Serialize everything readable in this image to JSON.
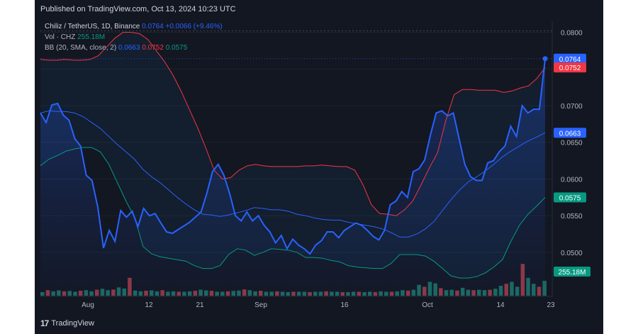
{
  "header": {
    "published": "Published on TradingView.com, Oct 13, 2024 10:23 UTC"
  },
  "legend": {
    "symbol": "Chiliz / TetherUS, 1D, Binance",
    "price": "0.0764",
    "change": "+0.0066 (+9.46%)",
    "vol_label": "Vol · CHZ",
    "vol_value": "255.18M",
    "bb_label": "BB (20, SMA, close, 2)",
    "bb_basis": "0.0663",
    "bb_upper": "0.0752",
    "bb_lower": "0.0575"
  },
  "footer": {
    "brand": "TradingView"
  },
  "colors": {
    "price": "#2962ff",
    "upper": "#f23645",
    "lower": "#089981",
    "basis": "#2962ff",
    "bg": "#131722"
  },
  "chart_data": {
    "type": "line",
    "y_ticks": [
      "0.0800",
      "0.0750",
      "0.0700",
      "0.0650",
      "0.0600",
      "0.0550",
      "0.0500"
    ],
    "x_ticks": [
      "Aug",
      "12",
      "21",
      "Sep",
      "16",
      "Oct",
      "14",
      "23"
    ],
    "ylim": [
      0.044,
      0.0815
    ],
    "price_labels": {
      "last": "0.0764",
      "upper": "0.0752",
      "basis": "0.0663",
      "lower": "0.0575",
      "volume": "255.18M"
    },
    "x": [
      0,
      1,
      2,
      3,
      4,
      5,
      6,
      7,
      8,
      9,
      10,
      11,
      12,
      13,
      14,
      15,
      16,
      17,
      18,
      19,
      20,
      21,
      22,
      23,
      24,
      25,
      26,
      27,
      28,
      29,
      30,
      31,
      32,
      33,
      34,
      35,
      36,
      37,
      38,
      39,
      40,
      41,
      42,
      43,
      44,
      45,
      46,
      47,
      48,
      49,
      50,
      51,
      52,
      53,
      54,
      55,
      56,
      57,
      58,
      59,
      60,
      61,
      62,
      63,
      64,
      65,
      66,
      67,
      68,
      69,
      70,
      71,
      72,
      73,
      74,
      75,
      76,
      77,
      78,
      79,
      80,
      81,
      82,
      83,
      84,
      85,
      86,
      87,
      88,
      89,
      90,
      91,
      92,
      93,
      94,
      95,
      96,
      97,
      98,
      99,
      100,
      101,
      102,
      103,
      104,
      105,
      106,
      107,
      108,
      109,
      110
    ],
    "series": [
      {
        "name": "Chiliz / TetherUS",
        "values": [
          0.069,
          0.0677,
          0.0701,
          0.0703,
          0.0687,
          0.068,
          0.0655,
          0.0645,
          0.0605,
          0.0598,
          0.0562,
          0.0506,
          0.053,
          0.0515,
          0.0557,
          0.0548,
          0.0556,
          0.0535,
          0.056,
          0.055,
          0.0553,
          0.054,
          0.0528,
          0.0526,
          0.0531,
          0.0536,
          0.0541,
          0.0548,
          0.0555,
          0.058,
          0.061,
          0.062,
          0.0605,
          0.058,
          0.055,
          0.0543,
          0.0555,
          0.0543,
          0.055,
          0.0537,
          0.0528,
          0.0513,
          0.0523,
          0.0505,
          0.0518,
          0.051,
          0.0505,
          0.0498,
          0.051,
          0.0516,
          0.0528,
          0.0528,
          0.052,
          0.053,
          0.0535,
          0.054,
          0.0537,
          0.053,
          0.0522,
          0.0517,
          0.053,
          0.0565,
          0.057,
          0.0583,
          0.0575,
          0.061,
          0.0614,
          0.0626,
          0.066,
          0.069,
          0.0693,
          0.0686,
          0.069,
          0.0655,
          0.062,
          0.0603,
          0.0598,
          0.0598,
          0.0622,
          0.0625,
          0.0637,
          0.0645,
          0.0672,
          0.0658,
          0.07,
          0.069,
          0.0695,
          0.0695,
          0.0764
        ]
      },
      {
        "name": "BB upper",
        "values": [
          0.0763,
          0.0762,
          0.0762,
          0.0763,
          0.0762,
          0.0762,
          0.0763,
          0.0768,
          0.078,
          0.0792,
          0.08,
          0.08,
          0.0798,
          0.079,
          0.0775,
          0.076,
          0.0742,
          0.072,
          0.0695,
          0.067,
          0.0642,
          0.0612,
          0.06,
          0.0602,
          0.0612,
          0.0618,
          0.062,
          0.0618,
          0.0617,
          0.0617,
          0.0617,
          0.0617,
          0.0618,
          0.0618,
          0.0619,
          0.0618,
          0.0617,
          0.0617,
          0.0612,
          0.0592,
          0.0565,
          0.0553,
          0.0552,
          0.055,
          0.0558,
          0.057,
          0.0592,
          0.0615,
          0.0636,
          0.068,
          0.0715,
          0.0722,
          0.0722,
          0.0721,
          0.0721,
          0.0721,
          0.0718,
          0.072,
          0.0724,
          0.0727,
          0.0737,
          0.0752
        ]
      },
      {
        "name": "BB basis",
        "values": [
          0.069,
          0.0693,
          0.0692,
          0.0692,
          0.069,
          0.0685,
          0.0677,
          0.0669,
          0.0658,
          0.0647,
          0.0637,
          0.0627,
          0.0613,
          0.0603,
          0.0595,
          0.0585,
          0.0575,
          0.0566,
          0.0558,
          0.0552,
          0.0551,
          0.0549,
          0.0551,
          0.0554,
          0.0557,
          0.0561,
          0.056,
          0.0558,
          0.0558,
          0.0556,
          0.0552,
          0.055,
          0.0547,
          0.0545,
          0.0544,
          0.0544,
          0.0541,
          0.0539,
          0.0537,
          0.0535,
          0.0532,
          0.0527,
          0.0521,
          0.0521,
          0.0525,
          0.0532,
          0.0542,
          0.0557,
          0.0572,
          0.0585,
          0.0596,
          0.0603,
          0.0611,
          0.062,
          0.063,
          0.0638,
          0.0645,
          0.0652,
          0.0657,
          0.0663
        ]
      },
      {
        "name": "BB lower",
        "values": [
          0.0618,
          0.0627,
          0.0632,
          0.0638,
          0.0641,
          0.0643,
          0.0643,
          0.0637,
          0.062,
          0.0595,
          0.057,
          0.0548,
          0.0508,
          0.0498,
          0.0494,
          0.0492,
          0.049,
          0.0488,
          0.0482,
          0.0478,
          0.0478,
          0.0482,
          0.0497,
          0.0505,
          0.0503,
          0.0496,
          0.05,
          0.0505,
          0.0504,
          0.0503,
          0.05,
          0.0493,
          0.0493,
          0.0492,
          0.0489,
          0.0487,
          0.0482,
          0.048,
          0.0479,
          0.0478,
          0.0478,
          0.0485,
          0.0497,
          0.0497,
          0.0497,
          0.0495,
          0.0488,
          0.0478,
          0.0468,
          0.0465,
          0.0465,
          0.0467,
          0.0472,
          0.048,
          0.049,
          0.0515,
          0.0537,
          0.0552,
          0.0563,
          0.0575
        ]
      }
    ]
  }
}
